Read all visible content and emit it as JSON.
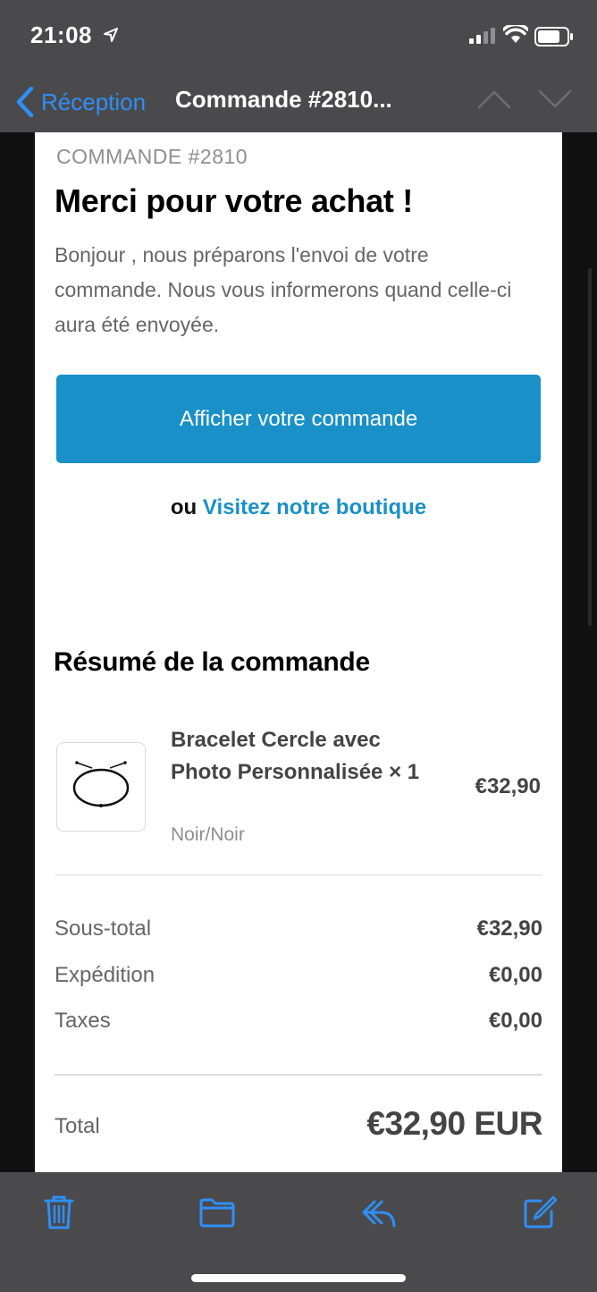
{
  "status_bar": {
    "time": "21:08"
  },
  "nav": {
    "back_label": "Réception",
    "title": "Commande #2810..."
  },
  "email": {
    "order_label": "COMMANDE #2810",
    "headline": "Merci pour votre achat !",
    "intro": "Bonjour , nous préparons l'envoi de votre commande. Nous vous informerons quand celle-ci aura été envoyée.",
    "cta_label": "Afficher votre commande",
    "alt_prefix": "ou",
    "alt_link": "Visitez notre boutique",
    "summary_title": "Résumé de la commande",
    "item": {
      "name": "Bracelet Cercle avec Photo Personnalisée × 1",
      "variant": "Noir/Noir",
      "price": "€32,90"
    },
    "totals": [
      {
        "label": "Sous-total",
        "value": "€32,90"
      },
      {
        "label": "Expédition",
        "value": "€0,00"
      },
      {
        "label": "Taxes",
        "value": "€0,00"
      }
    ],
    "total_label": "Total",
    "total_value": "€32,90 EUR"
  },
  "colors": {
    "accent": "#1a90c9",
    "ios_blue": "#2f8ff7"
  },
  "toolbar_icons": [
    "trash-icon",
    "folder-icon",
    "reply-icon",
    "compose-icon"
  ]
}
